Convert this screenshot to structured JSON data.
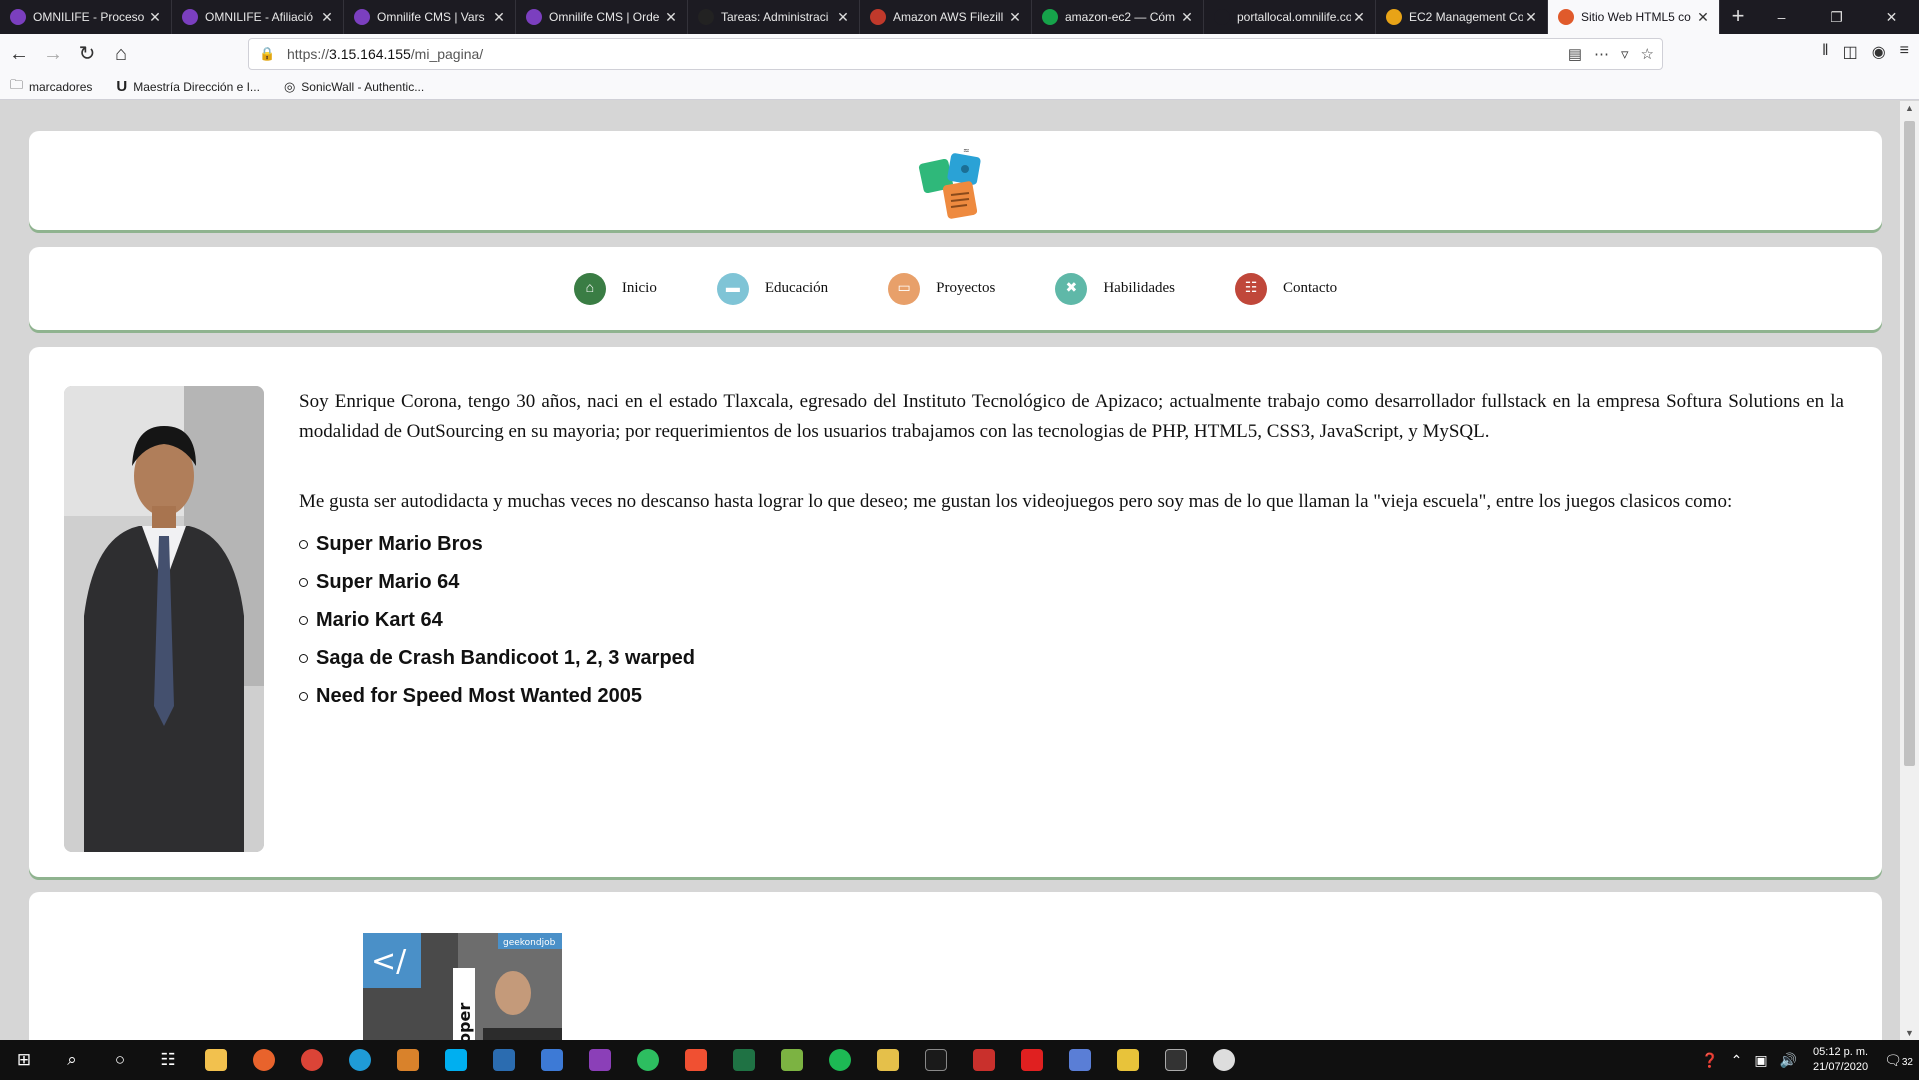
{
  "browser": {
    "tabs": [
      {
        "title": "OMNILIFE - Proceso",
        "color": "#7b3fbf"
      },
      {
        "title": "OMNILIFE - Afiliació",
        "color": "#7b3fbf"
      },
      {
        "title": "Omnilife CMS | Vars",
        "color": "#7b3fbf"
      },
      {
        "title": "Omnilife CMS | Orde",
        "color": "#7b3fbf"
      },
      {
        "title": "Tareas: Administraci",
        "color": "#222222"
      },
      {
        "title": "Amazon AWS Filezill",
        "color": "#c0392b"
      },
      {
        "title": "amazon-ec2 — Cóm",
        "color": "#16a34a"
      },
      {
        "title": "portallocal.omnilife.com",
        "color": "#1c1b22"
      },
      {
        "title": "EC2 Management Co",
        "color": "#e8a317"
      },
      {
        "title": "Sitio Web HTML5 co",
        "color": "#e05a2b",
        "active": true
      }
    ],
    "url_prefix": "https://",
    "url_host": "3.15.164.155",
    "url_path": "/mi_pagina/",
    "bookmarks": [
      {
        "label": "marcadores",
        "icon": "folder-icon"
      },
      {
        "label": "Maestría Dirección e I...",
        "icon": "u-logo-icon"
      },
      {
        "label": "SonicWall - Authentic...",
        "icon": "globe-icon"
      }
    ]
  },
  "page": {
    "menu": [
      {
        "label": "Inicio",
        "icon": "home-icon",
        "color": "#3a7d44"
      },
      {
        "label": "Educación",
        "icon": "book-icon",
        "color": "#7fc4d6"
      },
      {
        "label": "Proyectos",
        "icon": "folder-icon",
        "color": "#e8a06a"
      },
      {
        "label": "Habilidades",
        "icon": "tools-icon",
        "color": "#5fb8a8"
      },
      {
        "label": "Contacto",
        "icon": "address-book-icon",
        "color": "#c0473a"
      }
    ],
    "bio_p1": "Soy Enrique Corona, tengo 30 años, naci en el estado Tlaxcala, egresado del Instituto Tecnológico de Apizaco; actualmente trabajo como desarrollador fullstack en la empresa  Softura Solutions   en la modalidad de OutSourcing en su mayoria; por requerimientos de los usuarios trabajamos con las tecnologias de PHP, HTML5, CSS3, JavaScript, y MySQL.",
    "bio_p2": "Me gusta ser autodidacta y muchas veces no descanso hasta lograr lo que deseo; me gustan los videojuegos pero soy mas de lo que llaman la \"vieja escuela\", entre los juegos clasicos como:",
    "games": [
      "Super Mario Bros",
      "Super Mario 64",
      "Mario Kart 64",
      "Saga de Crash Bandicoot 1, 2, 3 warped",
      "Need for Speed Most Wanted 2005"
    ],
    "dev_image_caption": "developer",
    "dev_image_tag": "geekondjob"
  },
  "taskbar": {
    "time": "05:12 p. m.",
    "date": "21/07/2020",
    "notifications": "32"
  }
}
